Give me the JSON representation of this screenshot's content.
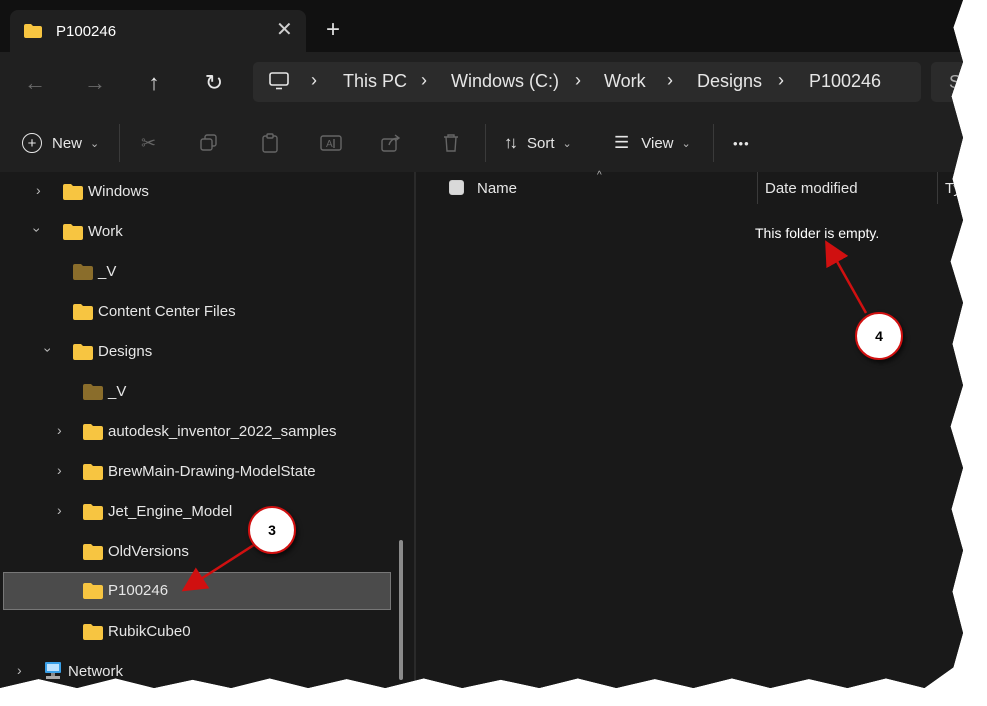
{
  "tab": {
    "title": "P100246",
    "close_icon": "close-icon",
    "new_tab_label": "+"
  },
  "address": {
    "crumbs": [
      "This PC",
      "Windows (C:)",
      "Work",
      "Designs",
      "P100246"
    ],
    "search_placeholder": "Se"
  },
  "toolbar": {
    "new_label": "New",
    "sort_label": "Sort",
    "view_label": "View",
    "more_label": "•••"
  },
  "tree": {
    "items": [
      {
        "label": "Windows"
      },
      {
        "label": "Work"
      },
      {
        "label": "_V"
      },
      {
        "label": "Content Center Files"
      },
      {
        "label": "Designs"
      },
      {
        "label": "_V"
      },
      {
        "label": "autodesk_inventor_2022_samples"
      },
      {
        "label": "BrewMain-Drawing-ModelState"
      },
      {
        "label": "Jet_Engine_Model"
      },
      {
        "label": "OldVersions"
      },
      {
        "label": "P100246"
      },
      {
        "label": "RubikCube0"
      },
      {
        "label": "Network"
      }
    ]
  },
  "columns": {
    "name": "Name",
    "date": "Date modified",
    "type": "Ty"
  },
  "content": {
    "empty_message": "This folder is empty."
  },
  "callouts": {
    "three": "3",
    "four": "4"
  },
  "colors": {
    "folder": "#f7c541",
    "folder_dark": "#8a6d2b",
    "annotation": "#d01010",
    "selected": "#4b4b4b"
  }
}
